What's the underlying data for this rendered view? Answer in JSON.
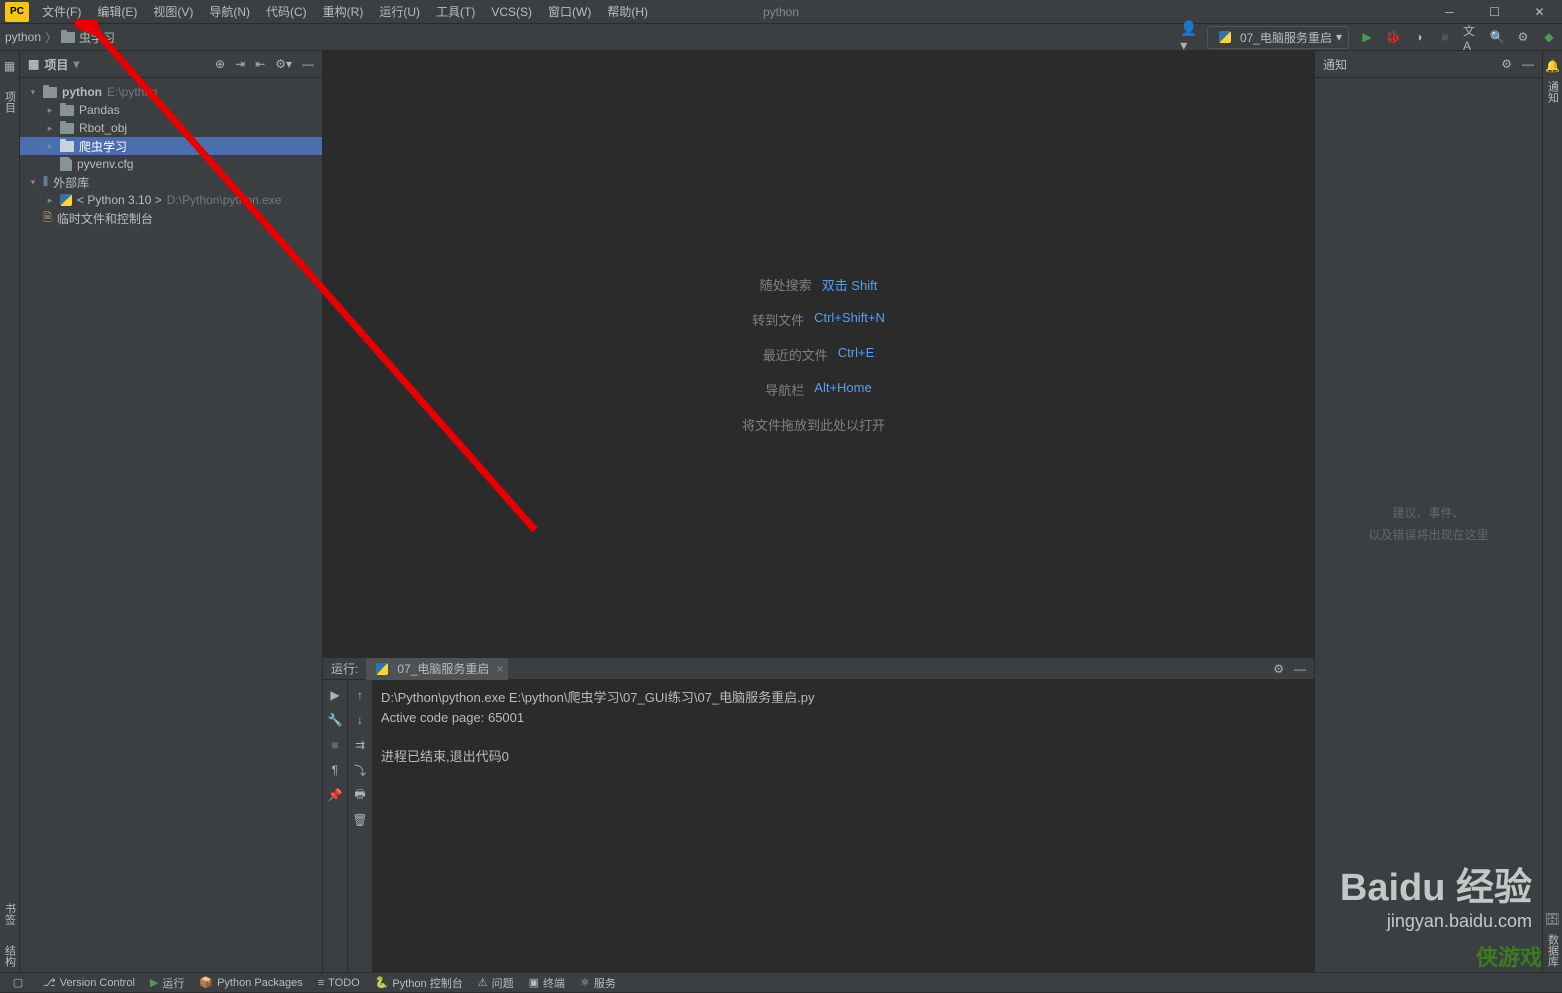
{
  "menubar": {
    "items": [
      "文件(F)",
      "编辑(E)",
      "视图(V)",
      "导航(N)",
      "代码(C)",
      "重构(R)",
      "运行(U)",
      "工具(T)",
      "VCS(S)",
      "窗口(W)",
      "帮助(H)"
    ],
    "title": "python"
  },
  "breadcrumb": {
    "root": "python",
    "sub": "虫学习"
  },
  "runConfig": "07_电脑服务重启",
  "projectPanel": {
    "title": "项目",
    "tree": {
      "root": "python",
      "rootPath": "E:\\python",
      "children": [
        "Pandas",
        "Rbot_obj",
        "爬虫学习",
        "pyvenv.cfg"
      ],
      "lib": "外部库",
      "pyver": "< Python 3.10 >",
      "pypath": "D:\\Python\\python.exe",
      "scratch": "临时文件和控制台"
    }
  },
  "editor": {
    "hints": [
      {
        "label": "随处搜索",
        "key": "双击 Shift"
      },
      {
        "label": "转到文件",
        "key": "Ctrl+Shift+N"
      },
      {
        "label": "最近的文件",
        "key": "Ctrl+E"
      },
      {
        "label": "导航栏",
        "key": "Alt+Home"
      }
    ],
    "drop": "将文件拖放到此处以打开"
  },
  "notif": {
    "title": "通知",
    "line1": "建议、事件、",
    "line2": "以及错误将出现在这里"
  },
  "run": {
    "title": "运行:",
    "tab": "07_电脑服务重启",
    "console": {
      "l1": "D:\\Python\\python.exe E:\\python\\爬虫学习\\07_GUI练习\\07_电脑服务重启.py",
      "l2": "Active code page: 65001",
      "l3": "进程已结束,退出代码0"
    }
  },
  "statusbar": {
    "vc": "Version Control",
    "run": "运行",
    "pkg": "Python Packages",
    "todo": "TODO",
    "pyc": "Python 控制台",
    "prob": "问题",
    "term": "终端",
    "svc": "服务"
  },
  "watermark": {
    "main": "Baidu 经验",
    "sub": "jingyan.baidu.com",
    "corner": "侠游戏"
  },
  "leftGutter": {
    "project": "项目",
    "bookmark": "书签"
  },
  "rightGutter": {
    "bell": "通知",
    "db": "数据库"
  }
}
